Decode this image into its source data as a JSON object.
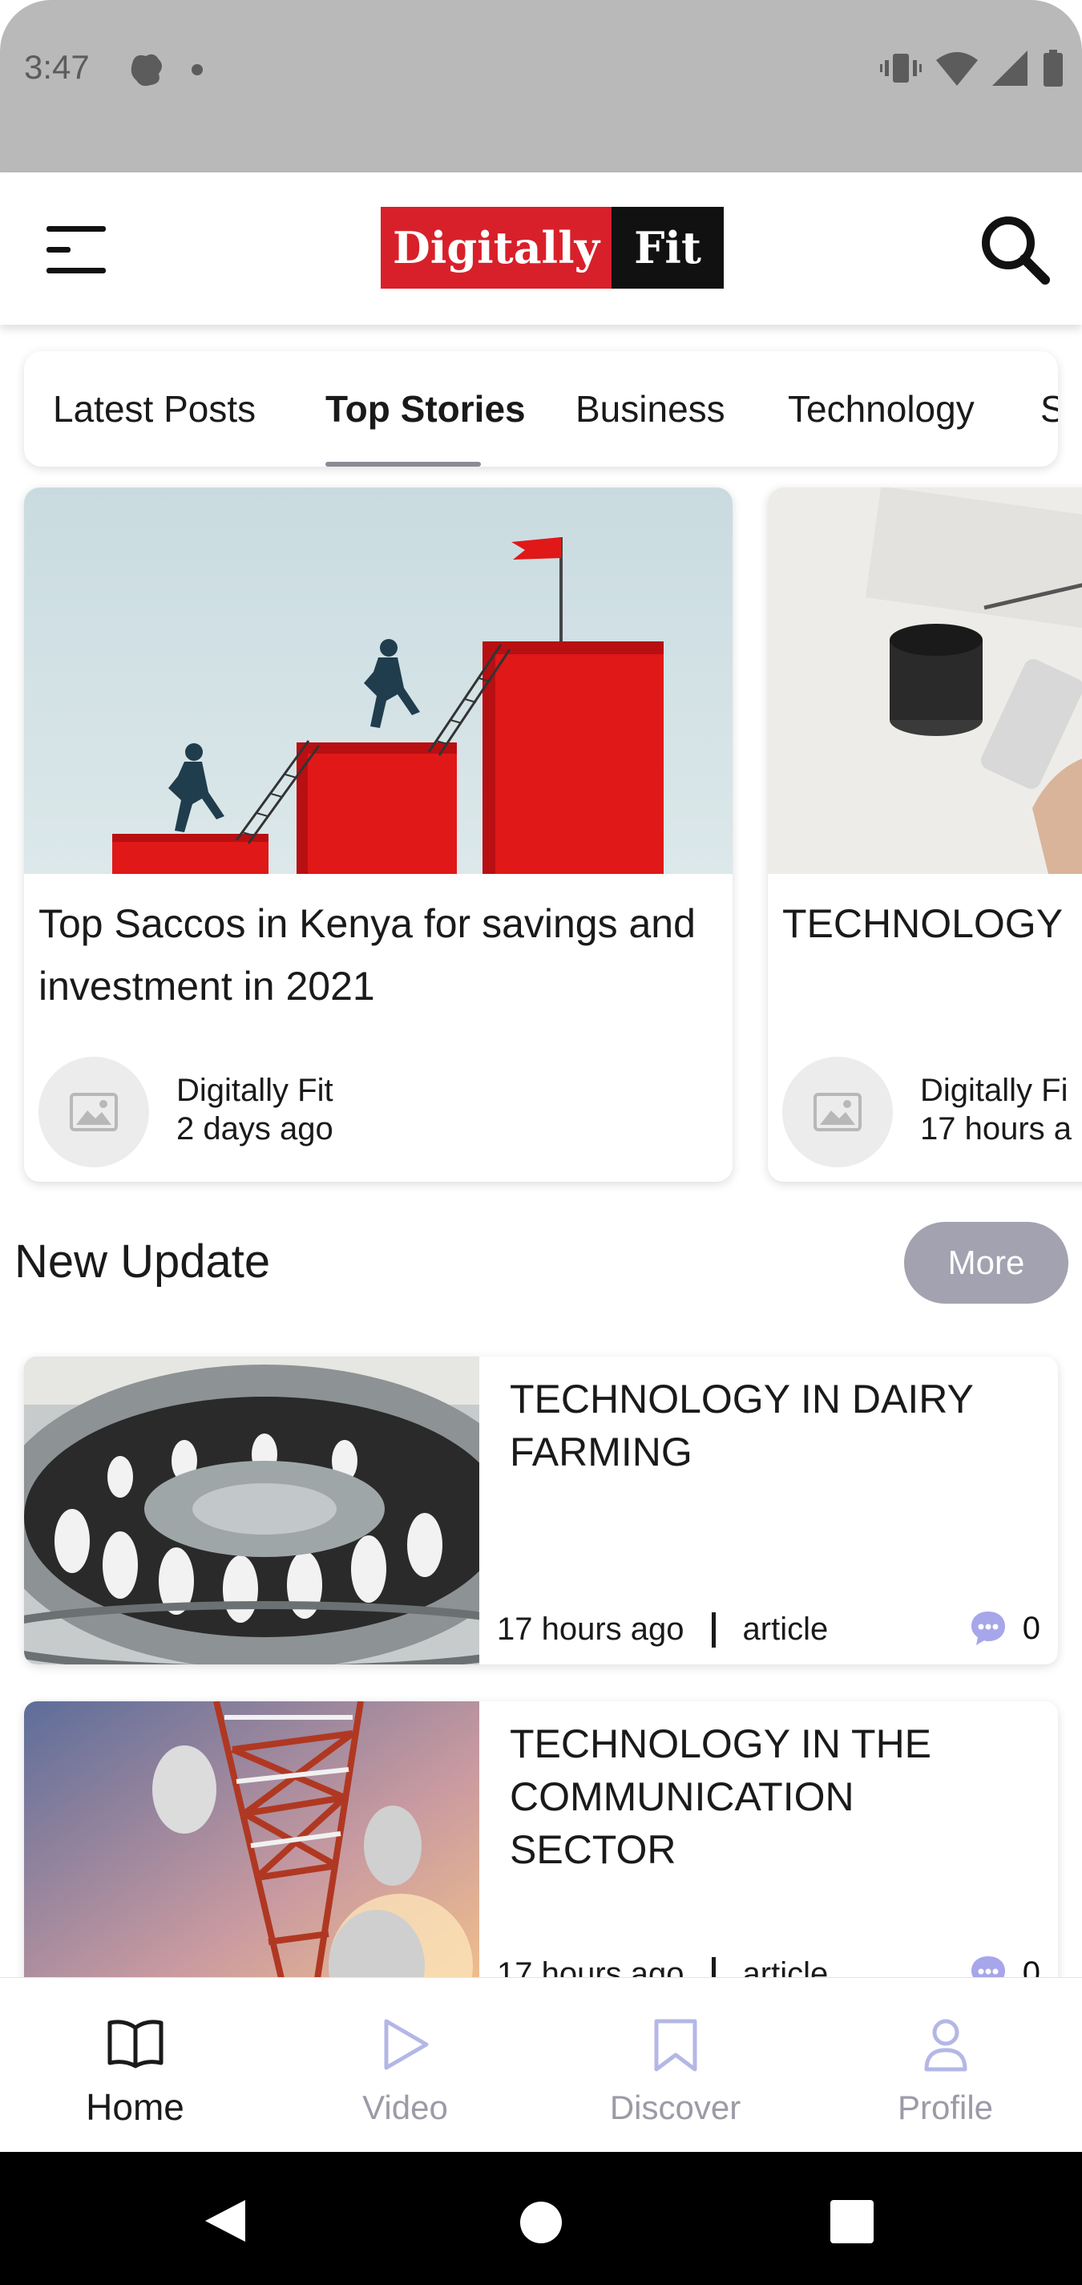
{
  "status_bar": {
    "time": "3:47"
  },
  "header": {
    "logo_part1": "Digitally",
    "logo_part2": "Fit"
  },
  "tabs": [
    {
      "label": "Latest Posts"
    },
    {
      "label": "Top Stories",
      "active": true
    },
    {
      "label": "Business"
    },
    {
      "label": "Technology"
    },
    {
      "label": "S"
    }
  ],
  "featured": [
    {
      "title": "Top Saccos in Kenya for savings and investment in 2021",
      "author": "Digitally Fit",
      "time": "2 days ago"
    },
    {
      "title": "TECHNOLOGY",
      "author": "Digitally Fi",
      "time": "17 hours a"
    }
  ],
  "new_update": {
    "title": "New Update",
    "more_label": "More",
    "items": [
      {
        "title": "TECHNOLOGY IN DAIRY FARMING",
        "time": "17 hours ago",
        "type": "article",
        "comments": "0"
      },
      {
        "title": "TECHNOLOGY IN THE COMMUNICATION SECTOR",
        "time": "17 hours ago",
        "type": "article",
        "comments": "0"
      }
    ]
  },
  "bottom_nav": [
    {
      "label": "Home",
      "icon": "book-icon",
      "active": true
    },
    {
      "label": "Video",
      "icon": "play-icon"
    },
    {
      "label": "Discover",
      "icon": "bookmark-icon"
    },
    {
      "label": "Profile",
      "icon": "user-icon"
    }
  ],
  "colors": {
    "brand_red": "#d8202a",
    "muted_button": "#a3a2b0",
    "inactive_nav": "#9b9ba8",
    "comment_icon": "#a7a6ea"
  }
}
